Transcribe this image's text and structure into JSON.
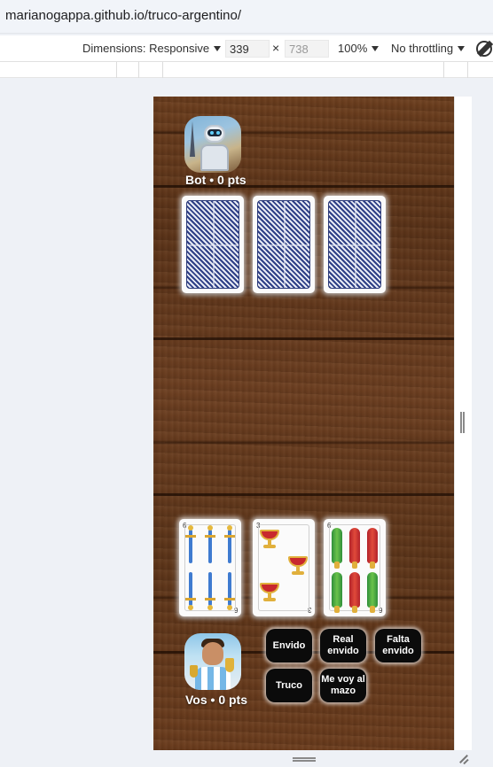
{
  "browser": {
    "url": "marianogappa.github.io/truco-argentino/"
  },
  "devtools": {
    "dimensions_label": "Dimensions: Responsive",
    "width_value": "339",
    "height_placeholder": "738",
    "times": "×",
    "zoom": "100%",
    "throttling": "No throttling",
    "icons": [
      "rotate-icon"
    ]
  },
  "game": {
    "bot": {
      "name": "Bot",
      "score_label": "Bot • 0 pts",
      "hand": [
        "card-back",
        "card-back",
        "card-back"
      ]
    },
    "player": {
      "name": "Vos",
      "score_label": "Vos • 0 pts",
      "hand": [
        {
          "rank": "6",
          "suit": "espadas",
          "corner": "6"
        },
        {
          "rank": "3",
          "suit": "copas",
          "corner": "3"
        },
        {
          "rank": "6",
          "suit": "bastos",
          "corner": "6"
        }
      ]
    },
    "actions": {
      "envido": "Envido",
      "real_envido": "Real envido",
      "falta_envido": "Falta envido",
      "truco": "Truco",
      "me_voy_al_mazo": "Me voy al mazo"
    }
  }
}
